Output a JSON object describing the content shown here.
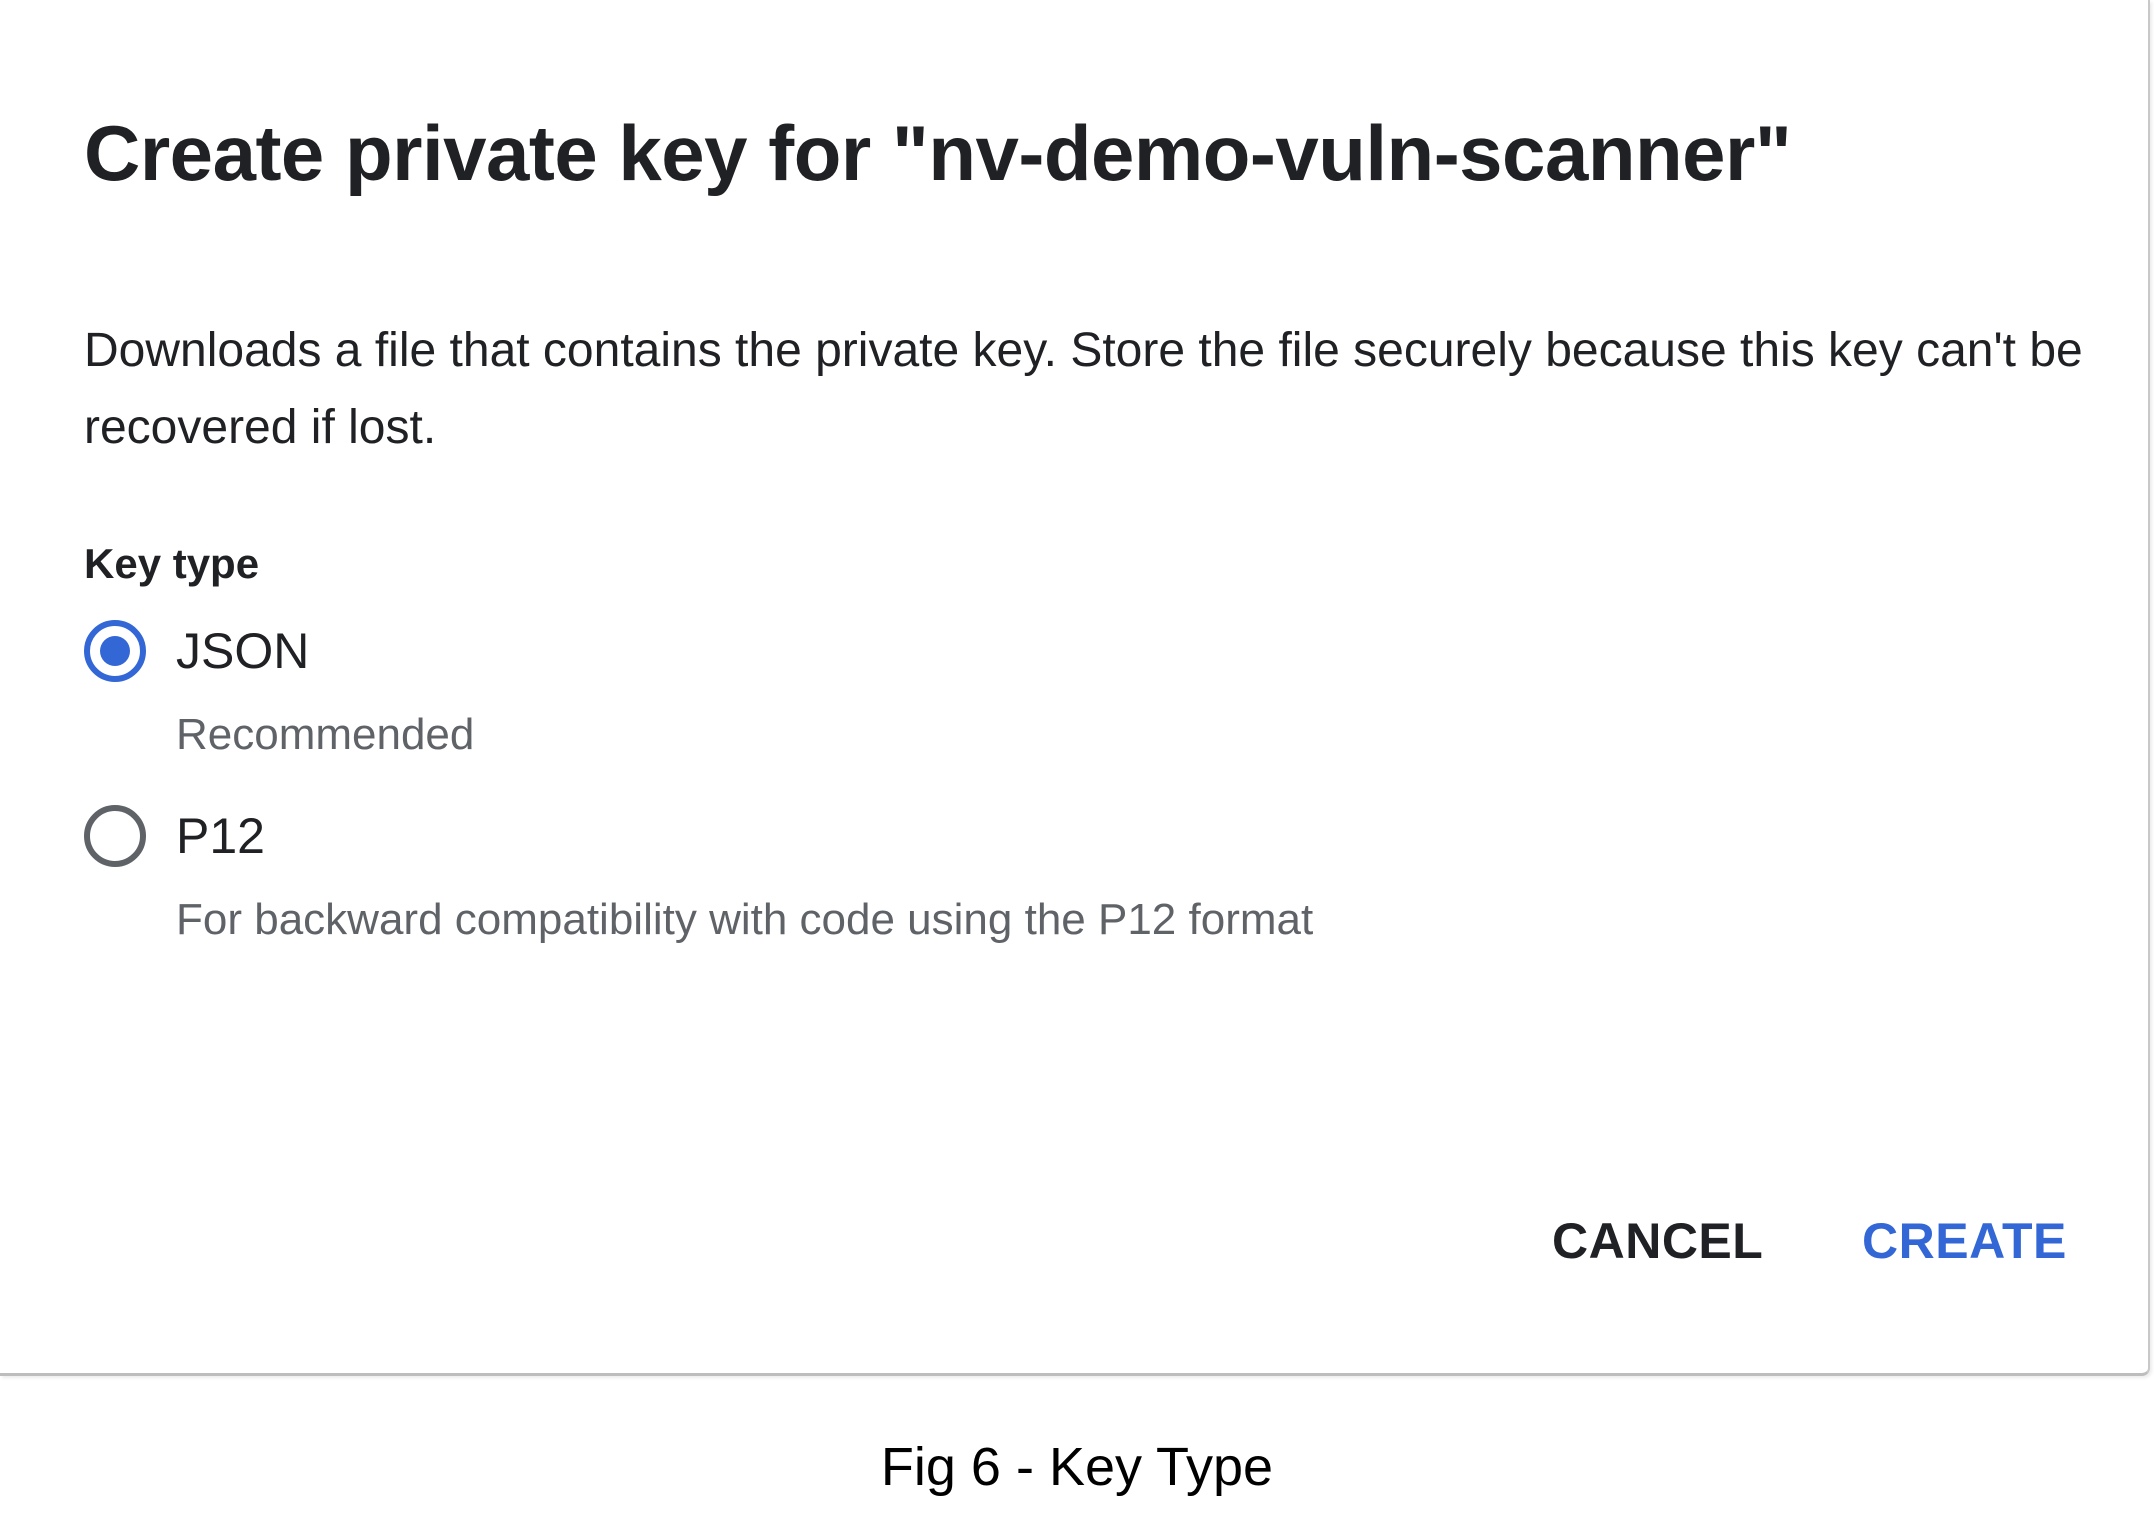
{
  "dialog": {
    "title": "Create private key for \"nv-demo-vuln-scanner\"",
    "description": "Downloads a file that contains the private key. Store the file securely because this key can't be recovered if lost.",
    "key_type_label": "Key type",
    "options": [
      {
        "label": "JSON",
        "description": "Recommended",
        "selected": true
      },
      {
        "label": "P12",
        "description": "For backward compatibility with code using the P12 format",
        "selected": false
      }
    ],
    "buttons": {
      "cancel": "CANCEL",
      "create": "CREATE"
    }
  },
  "caption": "Fig 6 - Key Type",
  "colors": {
    "accent": "#3367d6",
    "text_primary": "#202124",
    "text_secondary": "#5f6368"
  }
}
